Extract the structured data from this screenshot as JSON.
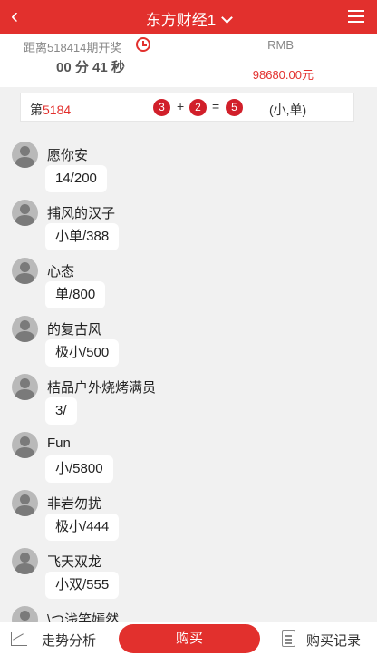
{
  "header": {
    "back_icon": "back-arrow-icon",
    "title": "东方财经1",
    "dropdown_icon": "chevron-down-icon",
    "menu_icon": "menu-icon"
  },
  "info": {
    "period_text": "距离518414期开奖",
    "clock_icon": "clock-icon",
    "countdown": "00 分 41 秒",
    "currency": "RMB",
    "balance": "98680.00元"
  },
  "result": {
    "label_prefix": "第",
    "period_number": "5184",
    "ball_1": "3",
    "plus": "+",
    "ball_2": "2",
    "equals": "=",
    "ball_3": "5",
    "kind": "(小,单)"
  },
  "messages": [
    {
      "name": "愿你安",
      "bet": "14/200"
    },
    {
      "name": "捕风的汉子",
      "bet": "小单/388"
    },
    {
      "name": "心态",
      "bet": "单/800"
    },
    {
      "name": "的复古风",
      "bet": "极小/500"
    },
    {
      "name": "桔品户外烧烤满员",
      "bet": "3/"
    },
    {
      "name": "Fun",
      "bet": "小/5800"
    },
    {
      "name": "非岩勿扰",
      "bet": "极小/444"
    },
    {
      "name": "飞天双龙",
      "bet": "小双/555"
    },
    {
      "name": "\\つ浅笑嫣然",
      "bet": ""
    }
  ],
  "footer": {
    "trend_icon": "line-chart-icon",
    "trend_label": "走势分析",
    "buy_label": "购买",
    "record_icon": "clipboard-icon",
    "record_label": "购买记录"
  },
  "colors": {
    "brand_red": "#e2302d",
    "ball_red": "#d11f2a",
    "background": "#f1f1f1"
  }
}
